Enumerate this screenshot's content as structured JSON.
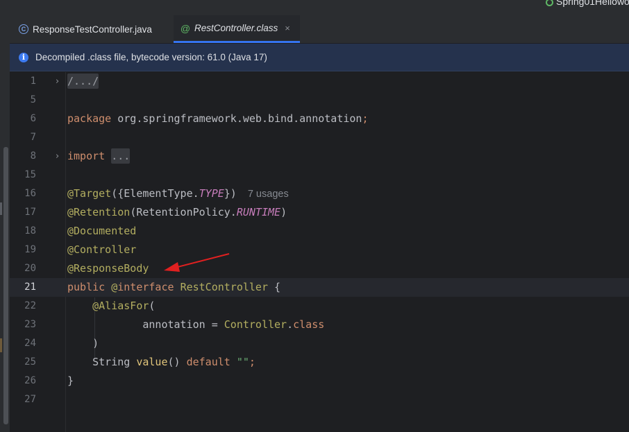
{
  "window": {
    "project_label": "Spring01Hellowo"
  },
  "tabs": [
    {
      "label": "ResponseTestController.java",
      "icon": "class-c-icon",
      "active": false
    },
    {
      "label": "RestController.class",
      "icon": "annotation-at-icon",
      "active": true,
      "close": "×"
    }
  ],
  "banner": {
    "text": "Decompiled .class file, bytecode version: 61.0 (Java 17)"
  },
  "editor": {
    "current_line": "21",
    "lines": [
      {
        "num": "1"
      },
      {
        "num": "5"
      },
      {
        "num": "6"
      },
      {
        "num": "7"
      },
      {
        "num": "8"
      },
      {
        "num": "15"
      },
      {
        "num": "16"
      },
      {
        "num": "17"
      },
      {
        "num": "18"
      },
      {
        "num": "19"
      },
      {
        "num": "20"
      },
      {
        "num": "21"
      },
      {
        "num": "22"
      },
      {
        "num": "23"
      },
      {
        "num": "24"
      },
      {
        "num": "25"
      },
      {
        "num": "26"
      },
      {
        "num": "27"
      }
    ],
    "tokens": {
      "l1_fold": "/.../",
      "l6_kw": "package",
      "l6_pkg": "org.springframework.web.bind.annotation",
      "semicolon": ";",
      "l8_kw": "import",
      "l8_fold": "...",
      "l16_ann": "@Target",
      "l16_open": "({ElementType.",
      "l16_const": "TYPE",
      "l16_close": "})",
      "l16_hint": "7 usages",
      "l17_ann": "@Retention",
      "l17_open": "(RetentionPolicy.",
      "l17_const": "RUNTIME",
      "l17_close": ")",
      "l18_ann": "@Documented",
      "l19_ann": "@Controller",
      "l20_ann": "@ResponseBody",
      "l21_kw": "public",
      "l21_at": "@",
      "l21_kw2": "interface",
      "l21_name": "RestController",
      "l21_brace": "{",
      "l22_ann": "@AliasFor",
      "l22_paren": "(",
      "l23_attr": "annotation = ",
      "l23_cls": "Controller",
      "l23_dot": ".",
      "l23_kw": "class",
      "l24_paren": ")",
      "l25_type": "String ",
      "l25_fn": "value",
      "l25_parens": "() ",
      "l25_kw": "default",
      "l25_str": "\"\"",
      "l26_brace": "}"
    }
  },
  "colors": {
    "background": "#1e1f22",
    "keyword": "#cf8e6d",
    "annotation": "#b3ae60",
    "constant": "#c77dbb",
    "accent": "#3574f0",
    "arrow": "#e02020"
  }
}
